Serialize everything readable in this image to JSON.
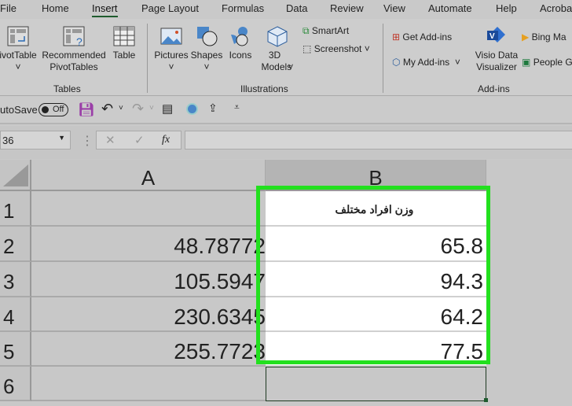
{
  "tabs": [
    "File",
    "Home",
    "Insert",
    "Page Layout",
    "Formulas",
    "Data",
    "Review",
    "View",
    "Automate",
    "Help",
    "Acroba"
  ],
  "active_tab": "Insert",
  "ribbon": {
    "tables": {
      "label": "Tables",
      "pivottable": "ivotTable",
      "recommended": "Recommended PivotTables",
      "table": "Table"
    },
    "illustrations": {
      "label": "Illustrations",
      "pictures": "Pictures",
      "shapes": "Shapes",
      "icons": "Icons",
      "models": "3D Models",
      "smartart": "SmartArt",
      "screenshot": "Screenshot"
    },
    "addins": {
      "label": "Add-ins",
      "get": "Get Add-ins",
      "my": "My Add-ins",
      "visio": "Visio Data Visualizer",
      "bing": "Bing Ma",
      "people": "People G"
    }
  },
  "qat": {
    "autosave": "utoSave",
    "toggle": "Off"
  },
  "formula_bar": {
    "name_box": "36",
    "fx": "fx",
    "value": ""
  },
  "columns": [
    "A",
    "B"
  ],
  "rows": [
    "1",
    "2",
    "3",
    "4",
    "5",
    "6"
  ],
  "col_a": [
    "",
    "48.78772",
    "105.5947",
    "230.6345",
    "255.7723",
    ""
  ],
  "col_b": [
    "وزن افراد مختلف",
    "65.8",
    "94.3",
    "64.2",
    "77.5",
    ""
  ],
  "colors": {
    "highlight": "#22e01e",
    "accent": "#1e5b2e"
  }
}
